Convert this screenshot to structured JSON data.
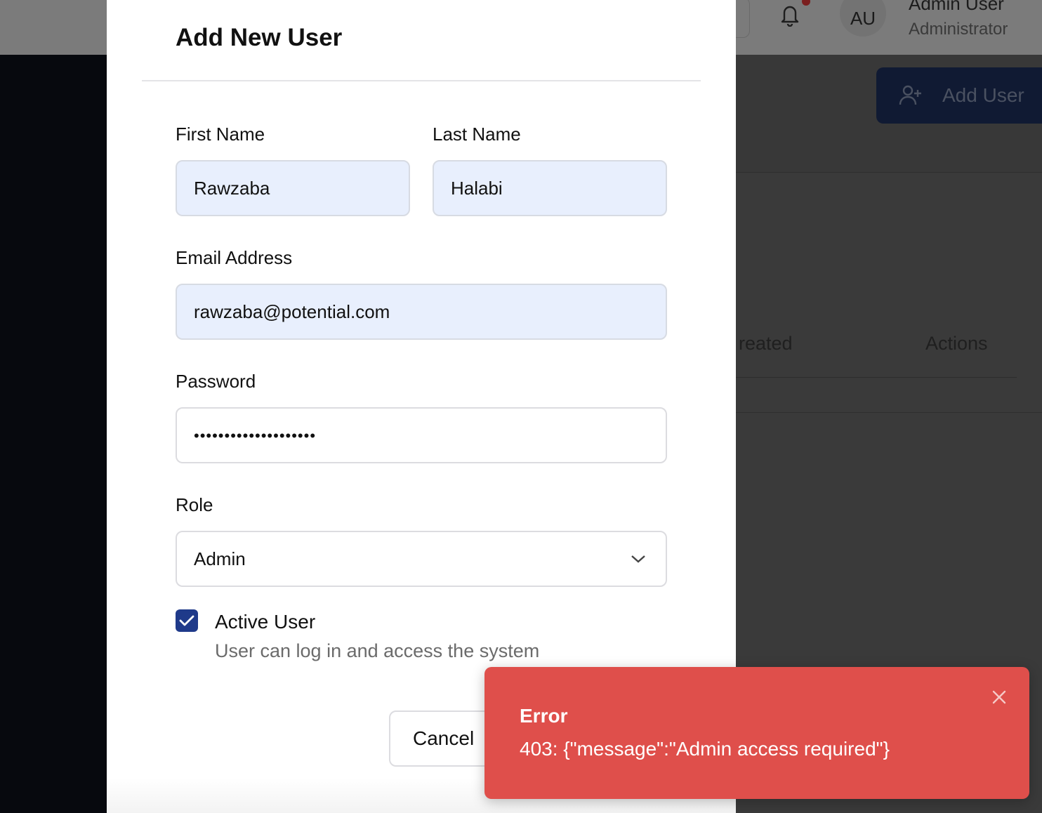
{
  "header": {
    "avatar_initials": "AU",
    "user_name": "Admin User",
    "user_role": "Administrator",
    "notification_icon": "bell-icon"
  },
  "page": {
    "add_user_label": "Add User",
    "add_user_icon": "user-plus-icon",
    "table_headers": [
      "Created",
      "Actions"
    ],
    "table_header_visible": [
      "reated",
      "Actions"
    ]
  },
  "modal": {
    "title": "Add New User",
    "first_name": {
      "label": "First Name",
      "value": "Rawzaba"
    },
    "last_name": {
      "label": "Last Name",
      "value": "Halabi"
    },
    "email": {
      "label": "Email Address",
      "value": "rawzaba@potential.com"
    },
    "password": {
      "label": "Password",
      "masked_value": "••••••••••••••••••••"
    },
    "role": {
      "label": "Role",
      "selected": "Admin"
    },
    "active": {
      "label": "Active User",
      "help": "User can log in and access the system",
      "checked": true
    },
    "cancel_label": "Cancel"
  },
  "toast": {
    "title": "Error",
    "message": "403: {\"message\":\"Admin access required\"}"
  },
  "colors": {
    "overlay": "#343434",
    "primary": "#1f3a8a",
    "error": "#df4f4b",
    "input_filled": "#e8effd"
  }
}
